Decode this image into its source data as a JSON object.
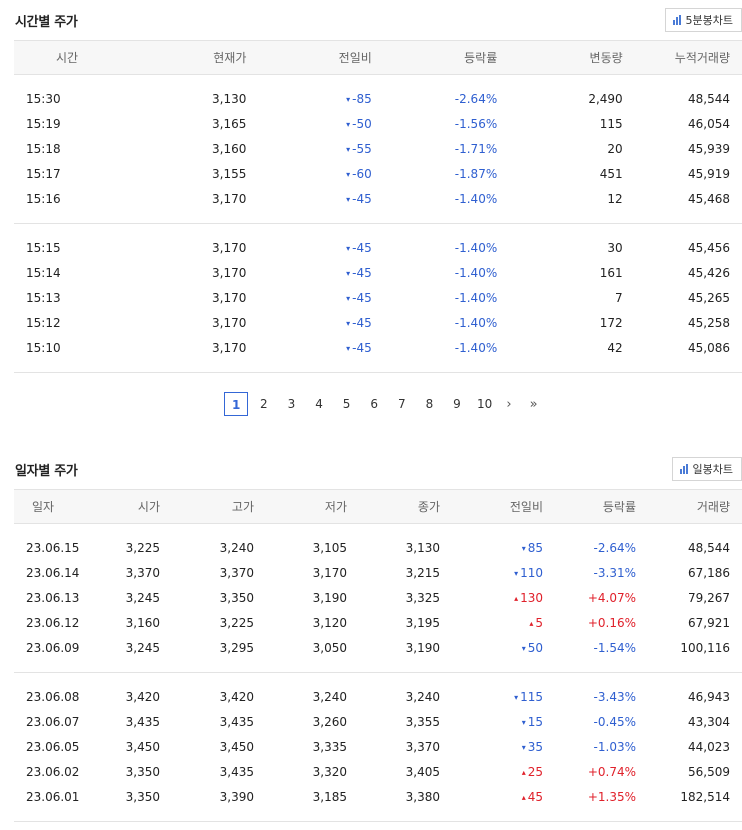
{
  "time_section": {
    "title": "시간별 주가",
    "chart_button": "5분봉차트",
    "headers": [
      "시간",
      "현재가",
      "전일비",
      "등락률",
      "변동량",
      "누적거래량"
    ],
    "groups": [
      [
        {
          "time": "15:30",
          "price": "3,130",
          "change": "85",
          "dir": "down",
          "rate": "-2.64%",
          "volume_change": "2,490",
          "cum_volume": "48,544"
        },
        {
          "time": "15:19",
          "price": "3,165",
          "change": "50",
          "dir": "down",
          "rate": "-1.56%",
          "volume_change": "115",
          "cum_volume": "46,054"
        },
        {
          "time": "15:18",
          "price": "3,160",
          "change": "55",
          "dir": "down",
          "rate": "-1.71%",
          "volume_change": "20",
          "cum_volume": "45,939"
        },
        {
          "time": "15:17",
          "price": "3,155",
          "change": "60",
          "dir": "down",
          "rate": "-1.87%",
          "volume_change": "451",
          "cum_volume": "45,919"
        },
        {
          "time": "15:16",
          "price": "3,170",
          "change": "45",
          "dir": "down",
          "rate": "-1.40%",
          "volume_change": "12",
          "cum_volume": "45,468"
        }
      ],
      [
        {
          "time": "15:15",
          "price": "3,170",
          "change": "45",
          "dir": "down",
          "rate": "-1.40%",
          "volume_change": "30",
          "cum_volume": "45,456"
        },
        {
          "time": "15:14",
          "price": "3,170",
          "change": "45",
          "dir": "down",
          "rate": "-1.40%",
          "volume_change": "161",
          "cum_volume": "45,426"
        },
        {
          "time": "15:13",
          "price": "3,170",
          "change": "45",
          "dir": "down",
          "rate": "-1.40%",
          "volume_change": "7",
          "cum_volume": "45,265"
        },
        {
          "time": "15:12",
          "price": "3,170",
          "change": "45",
          "dir": "down",
          "rate": "-1.40%",
          "volume_change": "172",
          "cum_volume": "45,258"
        },
        {
          "time": "15:10",
          "price": "3,170",
          "change": "45",
          "dir": "down",
          "rate": "-1.40%",
          "volume_change": "42",
          "cum_volume": "45,086"
        }
      ]
    ],
    "pagination": {
      "pages": [
        "1",
        "2",
        "3",
        "4",
        "5",
        "6",
        "7",
        "8",
        "9",
        "10"
      ],
      "active": "1",
      "next": "›",
      "last": "»"
    }
  },
  "daily_section": {
    "title": "일자별 주가",
    "chart_button": "일봉차트",
    "headers": [
      "일자",
      "시가",
      "고가",
      "저가",
      "종가",
      "전일비",
      "등락률",
      "거래량"
    ],
    "groups": [
      [
        {
          "date": "23.06.15",
          "open": "3,225",
          "high": "3,240",
          "low": "3,105",
          "close": "3,130",
          "change": "85",
          "dir": "down",
          "rate": "-2.64%",
          "volume": "48,544"
        },
        {
          "date": "23.06.14",
          "open": "3,370",
          "high": "3,370",
          "low": "3,170",
          "close": "3,215",
          "change": "110",
          "dir": "down",
          "rate": "-3.31%",
          "volume": "67,186"
        },
        {
          "date": "23.06.13",
          "open": "3,245",
          "high": "3,350",
          "low": "3,190",
          "close": "3,325",
          "change": "130",
          "dir": "up",
          "rate": "+4.07%",
          "volume": "79,267"
        },
        {
          "date": "23.06.12",
          "open": "3,160",
          "high": "3,225",
          "low": "3,120",
          "close": "3,195",
          "change": "5",
          "dir": "up",
          "rate": "+0.16%",
          "volume": "67,921"
        },
        {
          "date": "23.06.09",
          "open": "3,245",
          "high": "3,295",
          "low": "3,050",
          "close": "3,190",
          "change": "50",
          "dir": "down",
          "rate": "-1.54%",
          "volume": "100,116"
        }
      ],
      [
        {
          "date": "23.06.08",
          "open": "3,420",
          "high": "3,420",
          "low": "3,240",
          "close": "3,240",
          "change": "115",
          "dir": "down",
          "rate": "-3.43%",
          "volume": "46,943"
        },
        {
          "date": "23.06.07",
          "open": "3,435",
          "high": "3,435",
          "low": "3,260",
          "close": "3,355",
          "change": "15",
          "dir": "down",
          "rate": "-0.45%",
          "volume": "43,304"
        },
        {
          "date": "23.06.05",
          "open": "3,450",
          "high": "3,450",
          "low": "3,335",
          "close": "3,370",
          "change": "35",
          "dir": "down",
          "rate": "-1.03%",
          "volume": "44,023"
        },
        {
          "date": "23.06.02",
          "open": "3,350",
          "high": "3,435",
          "low": "3,320",
          "close": "3,405",
          "change": "25",
          "dir": "up",
          "rate": "+0.74%",
          "volume": "56,509"
        },
        {
          "date": "23.06.01",
          "open": "3,350",
          "high": "3,390",
          "low": "3,185",
          "close": "3,380",
          "change": "45",
          "dir": "up",
          "rate": "+1.35%",
          "volume": "182,514"
        }
      ]
    ]
  },
  "symbols": {
    "down_prefix": "▾-",
    "down_arrow": "▾",
    "up_arrow": "▴"
  },
  "colors": {
    "down": "#2f5fd0",
    "up": "#e0212b",
    "active_page": "#3467d6"
  }
}
